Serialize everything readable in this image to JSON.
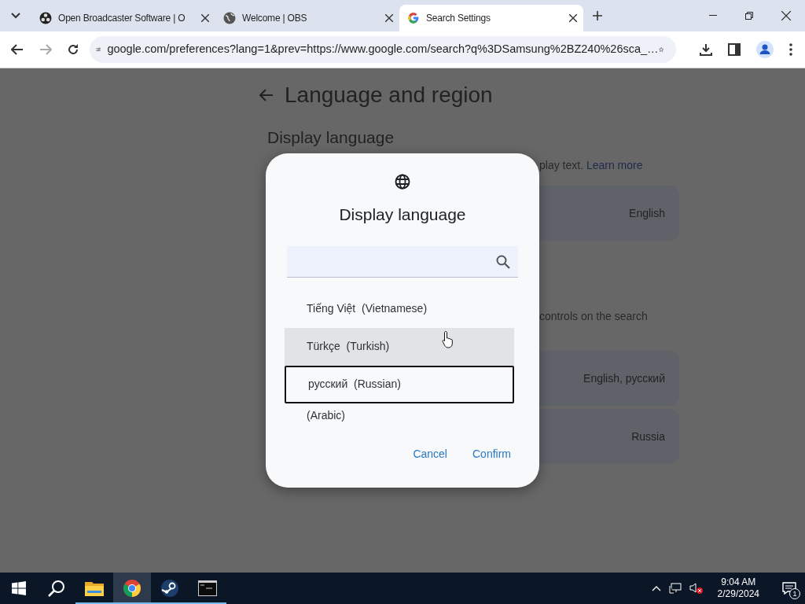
{
  "browser": {
    "tabs": [
      {
        "title": "Open Broadcaster Software | O",
        "kind": "obs",
        "selected": false
      },
      {
        "title": "Welcome | OBS",
        "kind": "globe",
        "selected": false
      },
      {
        "title": "Search Settings",
        "kind": "google",
        "selected": true
      }
    ],
    "address": "google.com/preferences?lang=1&prev=https://www.google.com/search?q%3DSamsung%2BZ240%26sca_…"
  },
  "page": {
    "title": "Language and region",
    "heading": "Display language",
    "note": "play text.",
    "note_link": "Learn more",
    "display_value": "English",
    "note2": "controls on the search",
    "rows": [
      {
        "value": "English, русский"
      },
      {
        "value": "Russia"
      }
    ]
  },
  "dialog": {
    "title": "Display language",
    "items": [
      {
        "label": "Tiếng Việt  (Vietnamese)",
        "hovered": false,
        "selected": false
      },
      {
        "label": "Türkçe  (Turkish)",
        "hovered": true,
        "selected": false
      },
      {
        "label": "русский  (Russian)",
        "hovered": false,
        "selected": true
      },
      {
        "label": "(Arabic)",
        "hovered": false,
        "selected": false
      }
    ],
    "buttons": [
      {
        "label": "Cancel"
      },
      {
        "label": "Confirm"
      }
    ]
  },
  "taskbar": {
    "apps": [
      {
        "kind": "folder",
        "selected": false
      },
      {
        "kind": "chrome",
        "selected": true
      },
      {
        "kind": "steam",
        "selected": false
      },
      {
        "kind": "terminal",
        "selected": false
      }
    ],
    "time": "9:04 AM",
    "date": "2/29/2024",
    "notifications": "1"
  }
}
